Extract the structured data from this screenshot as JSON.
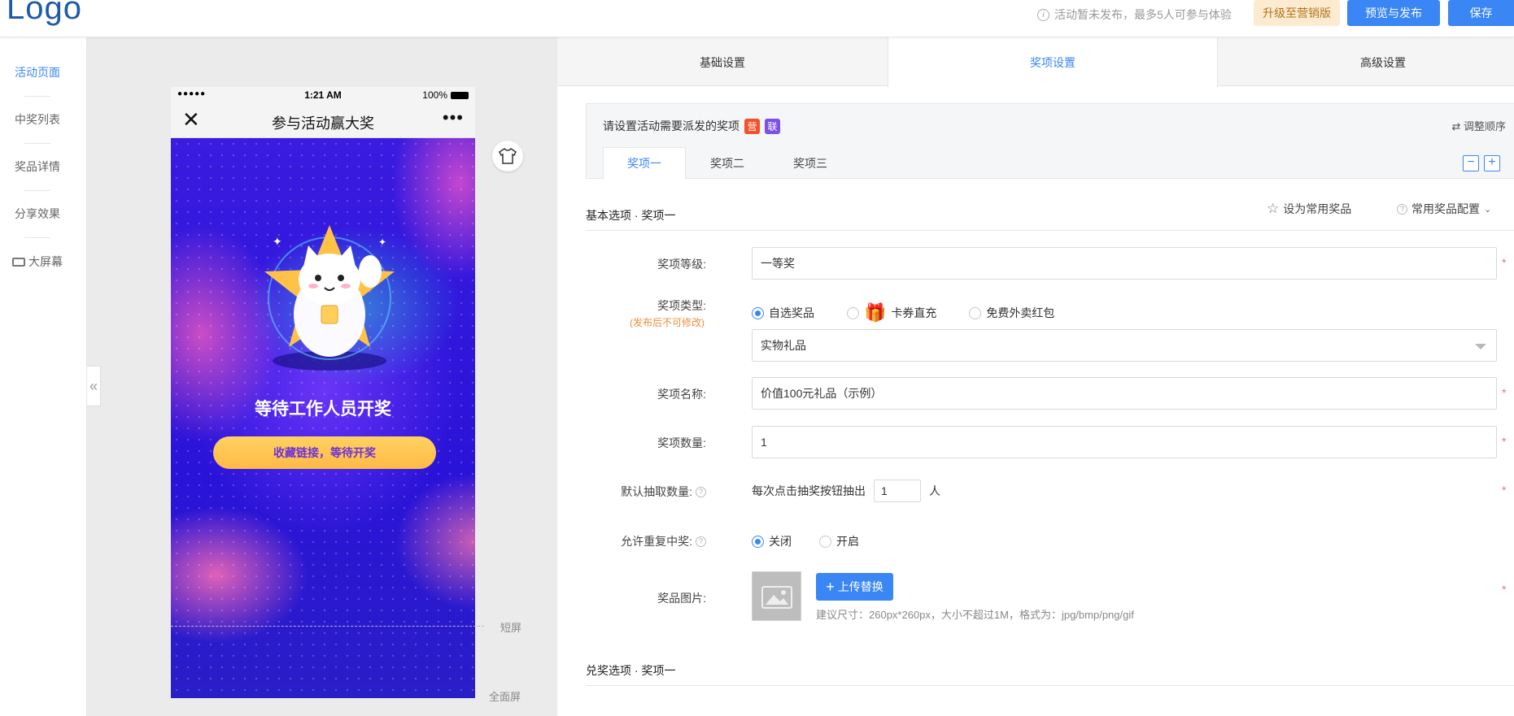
{
  "header": {
    "logo": "Logo",
    "notice": "活动暂未发布，最多5人可参与体验",
    "upgrade_label": "升级至营销版",
    "preview_label": "预览与发布",
    "save_label": "保存"
  },
  "leftnav": {
    "items": [
      {
        "label": "活动页面"
      },
      {
        "label": "中奖列表"
      },
      {
        "label": "奖品详情"
      },
      {
        "label": "分享效果"
      },
      {
        "label": "大屏幕"
      }
    ]
  },
  "preview": {
    "status_time": "1:21 AM",
    "status_battery": "100%",
    "status_dots": "●●●●●",
    "page_title": "参与活动赢大奖",
    "headline": "等待工作人员开奖",
    "cta_label": "收藏链接，等待开奖",
    "short_screen_label": "短屏",
    "full_screen_label": "全面屏",
    "collapse_glyph": "«"
  },
  "top_tabs": [
    {
      "label": "基础设置"
    },
    {
      "label": "奖项设置"
    },
    {
      "label": "高级设置"
    }
  ],
  "prize_box": {
    "title": "请设置活动需要派发的奖项",
    "tag_ying": "营",
    "tag_lian": "联",
    "reorder_label": "⇄ 调整顺序",
    "tabs": [
      {
        "label": "奖项一"
      },
      {
        "label": "奖项二"
      },
      {
        "label": "奖项三"
      }
    ],
    "minus": "−",
    "plus": "+"
  },
  "basic_section": {
    "title": "基本选项 · 奖项一",
    "fav_label": "设为常用奖品",
    "config_label": "常用奖品配置"
  },
  "form": {
    "level_label": "奖项等级:",
    "level_value": "一等奖",
    "type_label": "奖项类型:",
    "type_note": "(发布后不可修改)",
    "type_options": [
      {
        "label": "自选奖品"
      },
      {
        "label": "卡券直充"
      },
      {
        "label": "免费外卖红包"
      }
    ],
    "type_select_value": "实物礼品",
    "name_label": "奖项名称:",
    "name_value": "价值100元礼品（示例）",
    "qty_label": "奖项数量:",
    "qty_value": "1",
    "draw_label": "默认抽取数量:",
    "draw_prefix": "每次点击抽奖按钮抽出",
    "draw_value": "1",
    "draw_suffix": "人",
    "repeat_label": "允许重复中奖:",
    "repeat_options": [
      {
        "label": "关闭"
      },
      {
        "label": "开启"
      }
    ],
    "image_label": "奖品图片:",
    "upload_label": "上传替换",
    "upload_hint": "建议尺寸：260px*260px，大小不超过1M，格式为：jpg/bmp/png/gif",
    "required_mark": "*"
  },
  "redeem_section": {
    "title": "兑奖选项 · 奖项一"
  },
  "colors": {
    "accent": "#3a86f5",
    "upgrade_bg": "#fcebd1",
    "tag_ying": "#f2512b",
    "tag_lian": "#7b52e8",
    "warning": "#f08c3a",
    "required": "#f56c6c"
  }
}
